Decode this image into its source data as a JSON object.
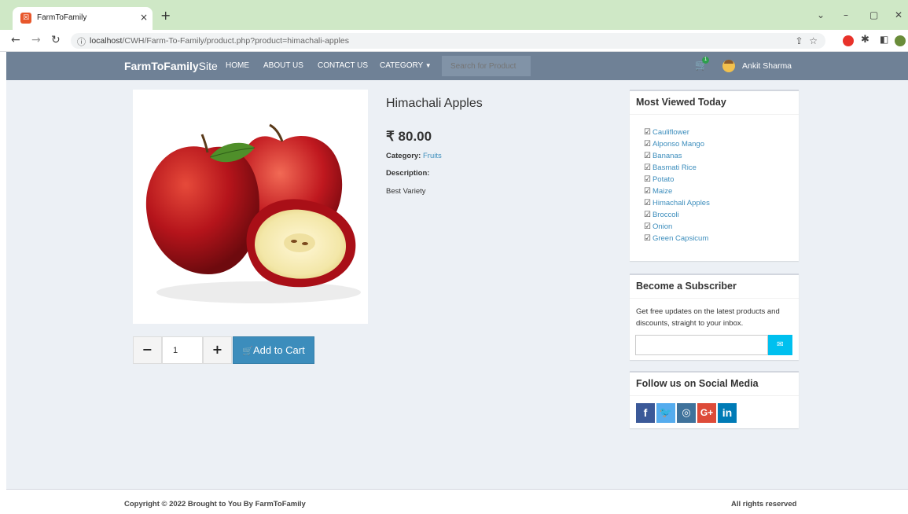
{
  "browser": {
    "tab_title": "FarmToFamily",
    "tab_close": "×",
    "new_tab": "+",
    "url_host": "localhost",
    "url_path": "/CWH/Farm-To-Family/product.php?product=himachali-apples"
  },
  "navbar": {
    "brand_bold": "FarmToFamily",
    "brand_light": "Site",
    "links": [
      "HOME",
      "ABOUT US",
      "CONTACT US",
      "CATEGORY"
    ],
    "search_placeholder": "Search for Product",
    "cart_count": "1",
    "user_name": "Ankit Sharma"
  },
  "product": {
    "name": "Himachali Apples",
    "price": "₹ 80.00",
    "category_label": "Category:",
    "category_value": "Fruits",
    "description_label": "Description:",
    "description": "Best Variety",
    "quantity": "1",
    "add_to_cart": "Add to Cart"
  },
  "most_viewed": {
    "title": "Most Viewed Today",
    "items": [
      "Cauliflower",
      "Alponso Mango",
      "Bananas",
      "Basmati Rice",
      "Potato",
      "Maize",
      "Himachali Apples",
      "Broccoli",
      "Onion",
      "Green Capsicum"
    ]
  },
  "subscriber": {
    "title": "Become a Subscriber",
    "text": "Get free updates on the latest products and discounts, straight to your inbox."
  },
  "social": {
    "title": "Follow us on Social Media",
    "icons": [
      {
        "name": "facebook",
        "glyph": "f",
        "color": "#3b5998"
      },
      {
        "name": "twitter",
        "glyph": "t",
        "color": "#55acee"
      },
      {
        "name": "instagram",
        "glyph": "◎",
        "color": "#3f729b"
      },
      {
        "name": "google-plus",
        "glyph": "G+",
        "color": "#dd4b39"
      },
      {
        "name": "linkedin",
        "glyph": "in",
        "color": "#007bb6"
      }
    ]
  },
  "footer": {
    "copyright": "Copyright © 2022 Brought to You By FarmToFamily",
    "rights": "All rights reserved"
  },
  "colors": {
    "nav_bg": "#6f8196",
    "page_bg": "#ecf0f5",
    "primary": "#3c8dbc",
    "info": "#00c0ef"
  }
}
